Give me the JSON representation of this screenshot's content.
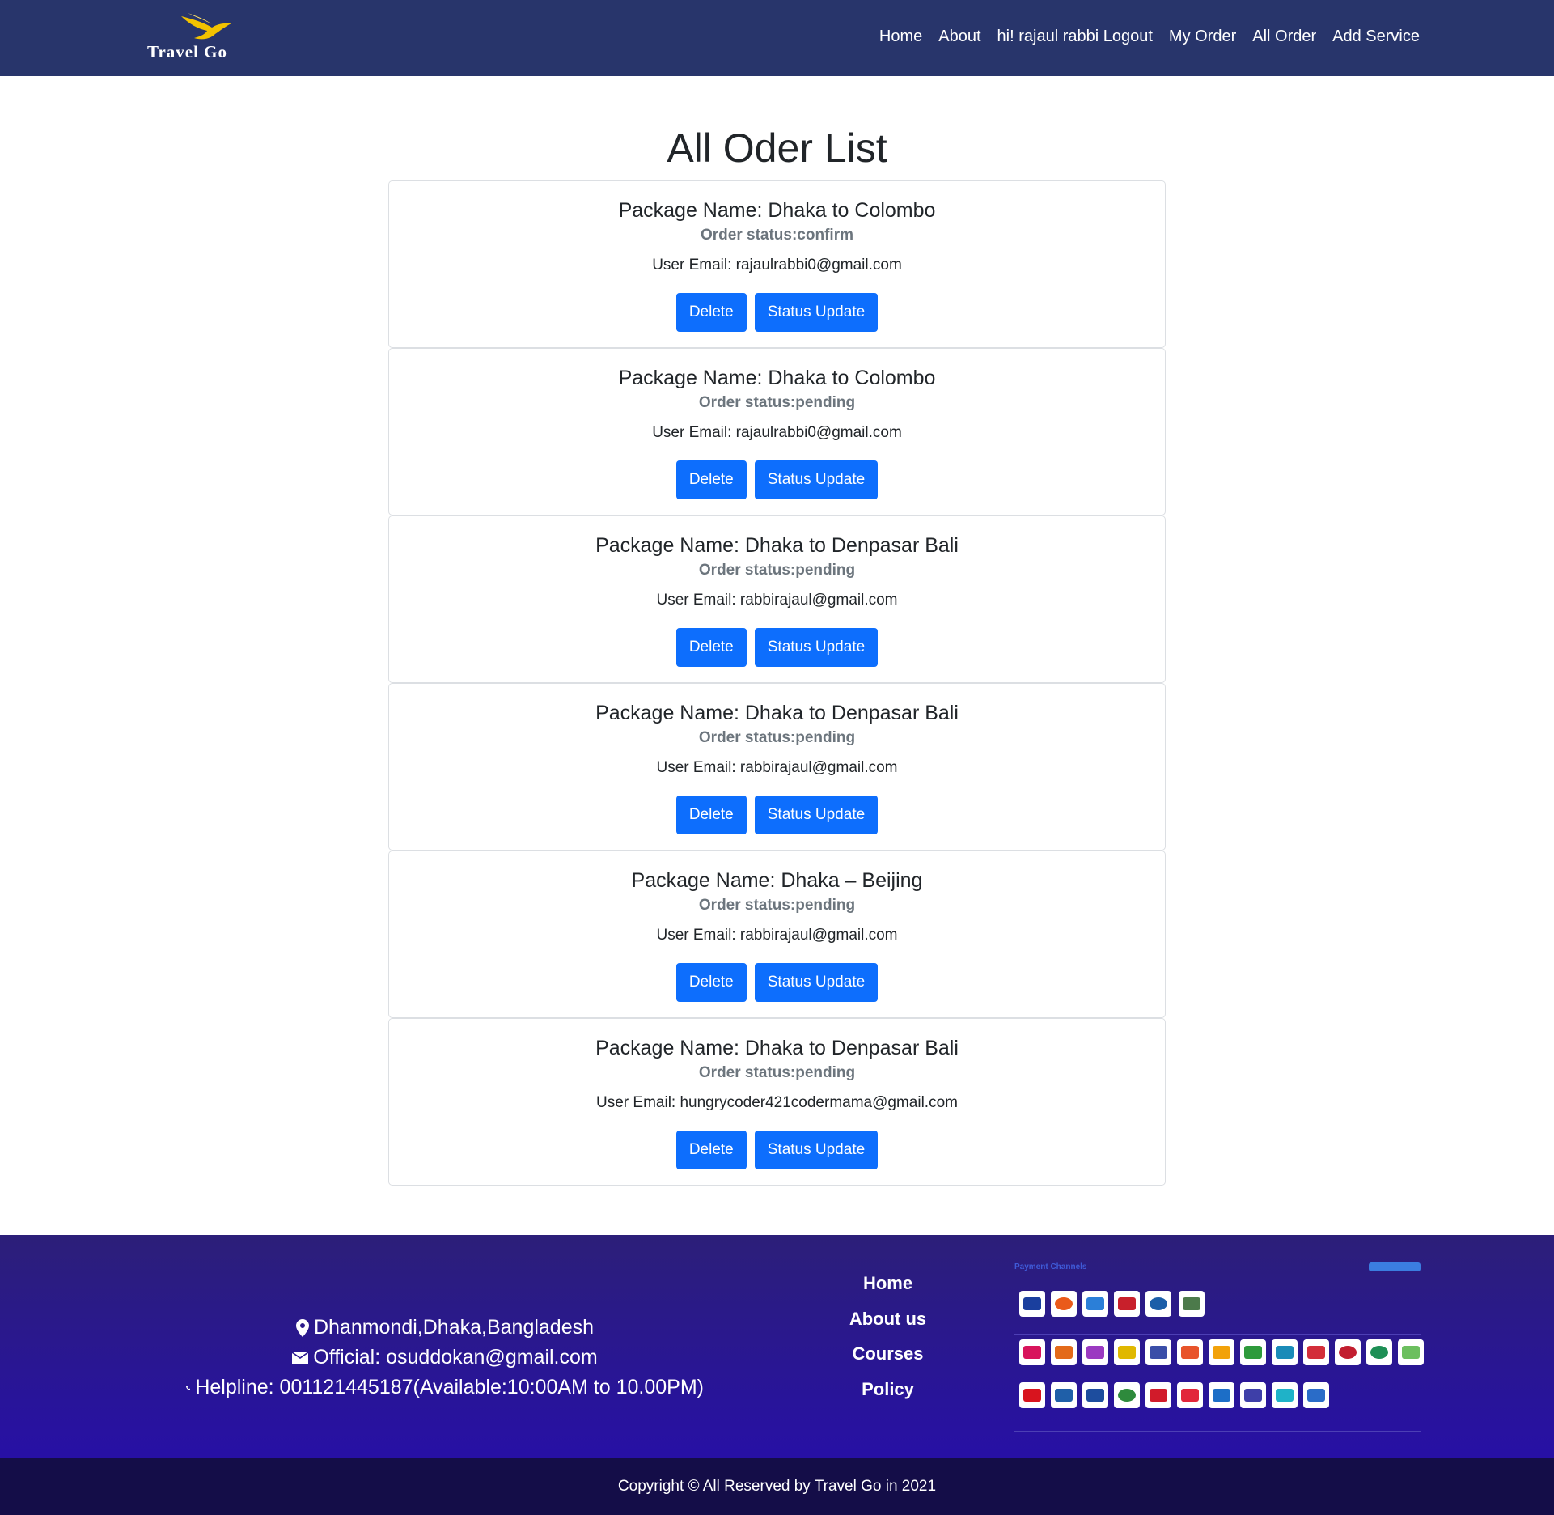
{
  "navbar": {
    "brand": "Travel Go",
    "links": [
      "Home",
      "About",
      "hi! rajaul rabbi Logout",
      "My Order",
      "All Order",
      "Add Service"
    ]
  },
  "page_title": "All Oder List",
  "orders": [
    {
      "package": "Package Name: Dhaka to Colombo",
      "status": "Order status:confirm",
      "email": "User Email: rajaulrabbi0@gmail.com",
      "delete_label": "Delete",
      "update_label": "Status Update"
    },
    {
      "package": "Package Name: Dhaka to Colombo",
      "status": "Order status:pending",
      "email": "User Email: rajaulrabbi0@gmail.com",
      "delete_label": "Delete",
      "update_label": "Status Update"
    },
    {
      "package": "Package Name: Dhaka to Denpasar Bali",
      "status": "Order status:pending",
      "email": "User Email: rabbirajaul@gmail.com",
      "delete_label": "Delete",
      "update_label": "Status Update"
    },
    {
      "package": "Package Name: Dhaka to Denpasar Bali",
      "status": "Order status:pending",
      "email": "User Email: rabbirajaul@gmail.com",
      "delete_label": "Delete",
      "update_label": "Status Update"
    },
    {
      "package": "Package Name: Dhaka – Beijing",
      "status": "Order status:pending",
      "email": "User Email: rabbirajaul@gmail.com",
      "delete_label": "Delete",
      "update_label": "Status Update"
    },
    {
      "package": "Package Name: Dhaka to Denpasar Bali",
      "status": "Order status:pending",
      "email": "User Email: hungrycoder421codermama@gmail.com",
      "delete_label": "Delete",
      "update_label": "Status Update"
    }
  ],
  "footer": {
    "address": "Dhanmondi,Dhaka,Bangladesh",
    "email": "Official: osuddokan@gmail.com",
    "helpline": "Helpline: 001121445187(Available:10:00AM to 10.00PM)",
    "links": [
      "Home",
      "About us",
      "Courses",
      "Policy"
    ],
    "payment_title": "Payment Channels",
    "copyright": "Copyright © All Reserved by Travel Go in 2021"
  },
  "colors": {
    "navbar": "#28356b",
    "button": "#0d6efd",
    "footer_top": "#2c1f79",
    "footer_bottom": "#2710a5",
    "copyright_bar": "#140d48"
  }
}
